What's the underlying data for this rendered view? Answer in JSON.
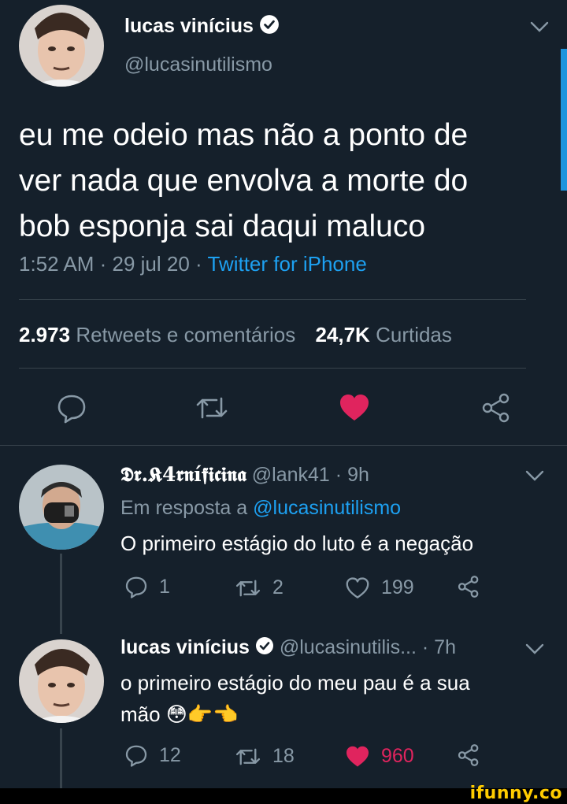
{
  "main_tweet": {
    "name": "lucas vinícius",
    "handle": "@lucasinutilismo",
    "text_lines": [
      "eu me odeio mas não a ponto de",
      "ver nada que envolva a morte do",
      "bob esponja sai daqui maluco"
    ],
    "time": "1:52 AM",
    "sep1": " · ",
    "date": "29 jul 20",
    "sep2": " · ",
    "source": "Twitter for iPhone",
    "retweets_count": "2.973",
    "retweets_label": "Retweets e comentários",
    "likes_count": "24,7K",
    "likes_label": "Curtidas"
  },
  "reply1": {
    "name": "𝕯𝖗.𝕶4𝖗𝖓í𝖋𝖎𝖈𝖎𝖓𝖆",
    "handle": "@lank41",
    "time": "· 9h",
    "in_reply_prefix": "Em resposta a",
    "in_reply_to": "@lucasinutilismo",
    "text": "O primeiro estágio do luto é a negação",
    "replies": "1",
    "retweets": "2",
    "likes": "199"
  },
  "reply2": {
    "name": "lucas vinícius",
    "handle": "@lucasinutilis...",
    "time": "· 7h",
    "text_line1": "o primeiro estágio do meu pau é a sua",
    "text_line2": "mão 😳👉👈",
    "replies": "12",
    "retweets": "18",
    "likes": "960"
  },
  "watermark": "ifunny.co",
  "colors": {
    "background": "#15202b",
    "accent": "#1da1f2",
    "like_red": "#e0245e",
    "muted": "#8899a6"
  }
}
